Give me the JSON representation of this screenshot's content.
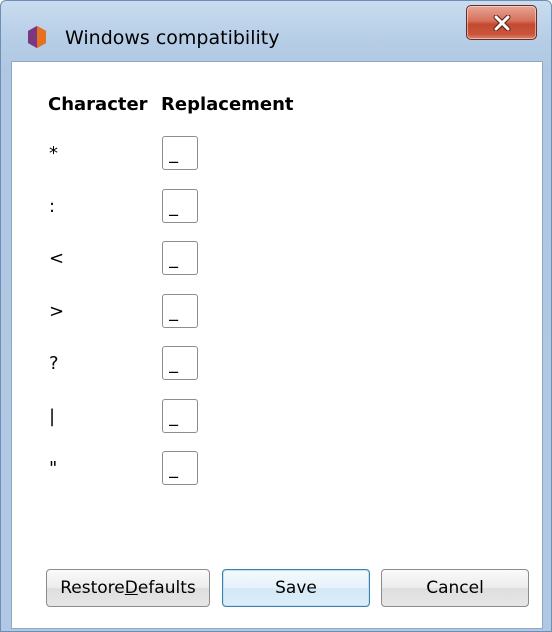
{
  "window": {
    "title": "Windows compatibility",
    "app_icon": "hexagon-app-icon",
    "close_icon": "close-x-icon",
    "accent_colors": {
      "close_button": "#c8543a",
      "titlebar": "#b6cde6",
      "icon_purple": "#6b2f73",
      "icon_orange": "#e8711e"
    }
  },
  "table": {
    "header_character": "Character",
    "header_replacement": "Replacement",
    "rows": [
      {
        "character": "*",
        "replacement": "_"
      },
      {
        "character": ":",
        "replacement": "_"
      },
      {
        "character": "<",
        "replacement": "_"
      },
      {
        "character": ">",
        "replacement": "_"
      },
      {
        "character": "?",
        "replacement": "_"
      },
      {
        "character": "|",
        "replacement": "_"
      },
      {
        "character": "\"",
        "replacement": "_"
      }
    ]
  },
  "buttons": {
    "restore_before": "Restore ",
    "restore_mnemonic": "D",
    "restore_after": "efaults",
    "save": "Save",
    "cancel": "Cancel"
  }
}
